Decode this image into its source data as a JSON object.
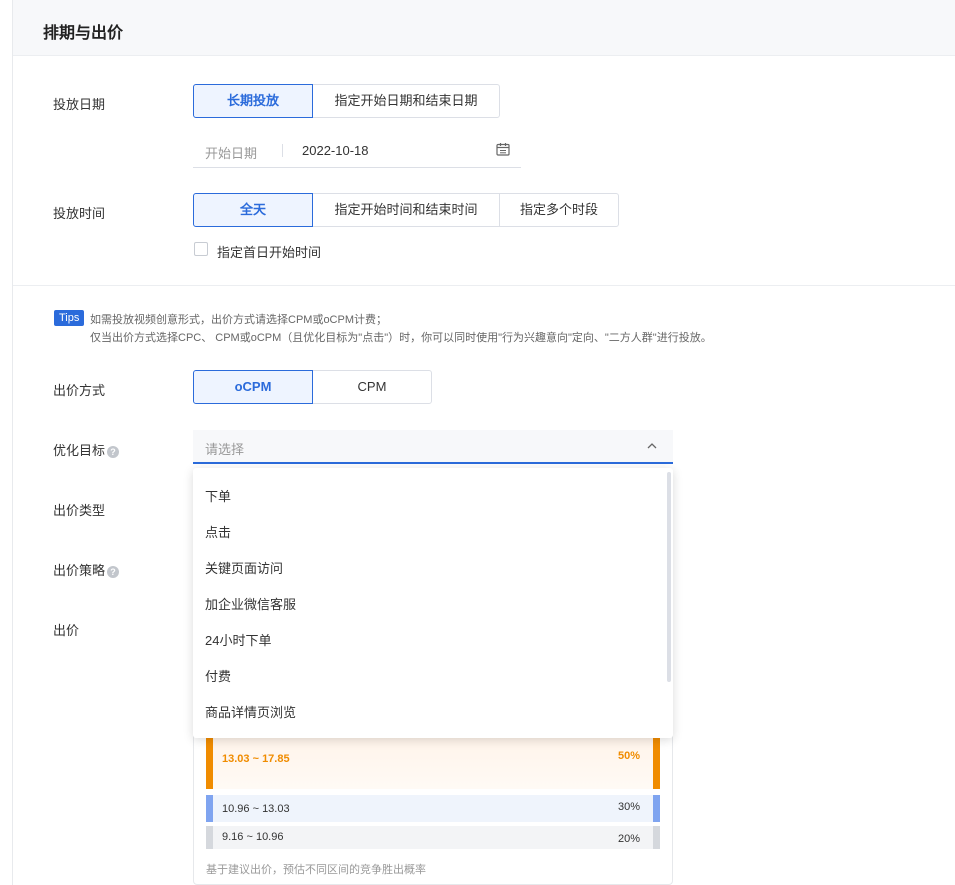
{
  "section_title": "排期与出价",
  "schedule": {
    "date_label": "投放日期",
    "date_options": [
      "长期投放",
      "指定开始日期和结束日期"
    ],
    "start_date_placeholder": "开始日期",
    "start_date_value": "2022-10-18",
    "time_label": "投放时间",
    "time_options": [
      "全天",
      "指定开始时间和结束时间",
      "指定多个时段"
    ],
    "first_day_checkbox": "指定首日开始时间"
  },
  "tips": {
    "badge": "Tips",
    "line1": "如需投放视频创意形式，出价方式请选择CPM或oCPM计费；",
    "line2": "仅当出价方式选择CPC、 CPM或oCPM（且优化目标为\"点击\"）时，你可以同时使用\"行为兴趣意向\"定向、\"二方人群\"进行投放。"
  },
  "bid": {
    "method_label": "出价方式",
    "method_options": [
      "oCPM",
      "CPM"
    ],
    "goal_label": "优化目标",
    "goal_placeholder": "请选择",
    "type_label": "出价类型",
    "strategy_label": "出价策略",
    "bid_label": "出价",
    "goal_options": [
      "下单",
      "点击",
      "关键页面访问",
      "加企业微信客服",
      "24小时下单",
      "付费",
      "商品详情页浏览"
    ]
  },
  "probability": {
    "bands": [
      {
        "range": "13.03 ~ 17.85",
        "percent": "50%"
      },
      {
        "range": "10.96 ~ 13.03",
        "percent": "30%"
      },
      {
        "range": "9.16 ~ 10.96",
        "percent": "20%"
      }
    ],
    "note": "基于建议出价，预估不同区间的竞争胜出概率"
  },
  "colors": {
    "accent": "#2b6bdb",
    "orange": "#f08c00",
    "blue_bar": "#7fa4f0",
    "gray_bar": "#d5d8dd"
  },
  "icons": {
    "calendar": "calendar-icon",
    "help": "help-icon",
    "chevron": "chevron-up-icon"
  }
}
